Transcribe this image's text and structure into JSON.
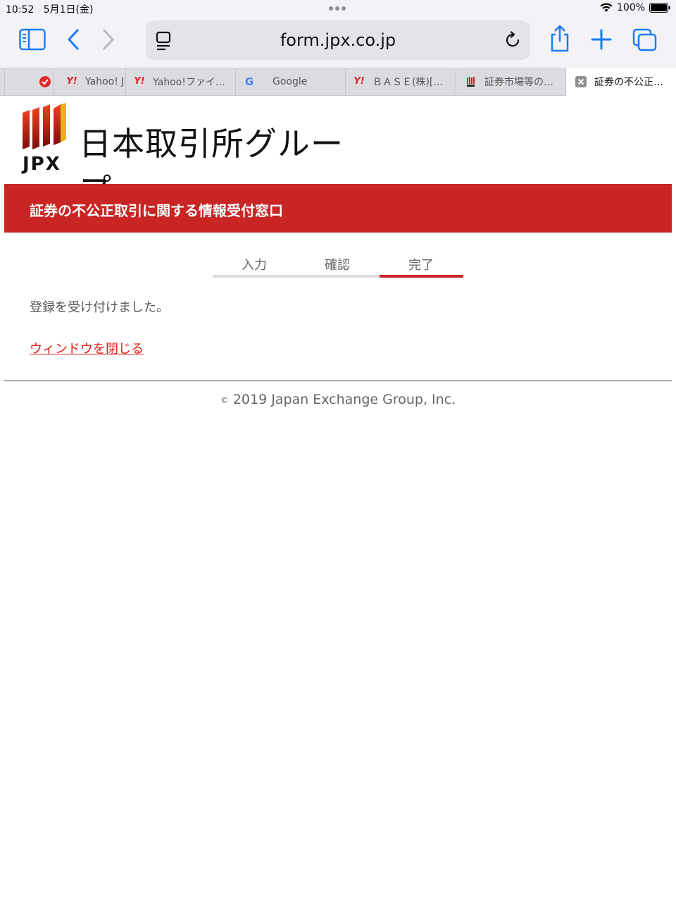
{
  "status": {
    "time": "10:52",
    "date": "5月1日(金)",
    "battery": "100%"
  },
  "toolbar": {
    "url": "form.jpx.co.jp"
  },
  "tabs": [
    {
      "label": "",
      "favicon": "red-heart-icon",
      "active": false
    },
    {
      "label": "Yahoo! J",
      "favicon": "Y!",
      "active": false
    },
    {
      "label": "Yahoo!ファイ…",
      "favicon": "Y!",
      "active": false
    },
    {
      "label": "Google",
      "favicon": "G",
      "active": false
    },
    {
      "label": "ＢＡＳＥ(株)[…",
      "favicon": "Y!",
      "active": false
    },
    {
      "label": "証券市場等の…",
      "favicon": "jpx-icon",
      "active": false
    },
    {
      "label": "証券の不公正…",
      "favicon": "close-icon",
      "active": true
    }
  ],
  "logo": {
    "text": "日本取引所グループ",
    "jpx": "JPX"
  },
  "banner": {
    "title": "証券の不公正取引に関する情報受付窓口"
  },
  "steps": {
    "items": [
      "入力",
      "確認",
      "完了"
    ],
    "current": 2
  },
  "main": {
    "message": "登録を受け付けました。",
    "close_link": "ウィンドウを閉じる"
  },
  "footer": {
    "copyright_symbol": "©",
    "text": "2019 Japan Exchange Group, Inc."
  },
  "colors": {
    "accent": "#c92525",
    "link": "#e0201a",
    "ios_blue": "#1a7cf5"
  }
}
